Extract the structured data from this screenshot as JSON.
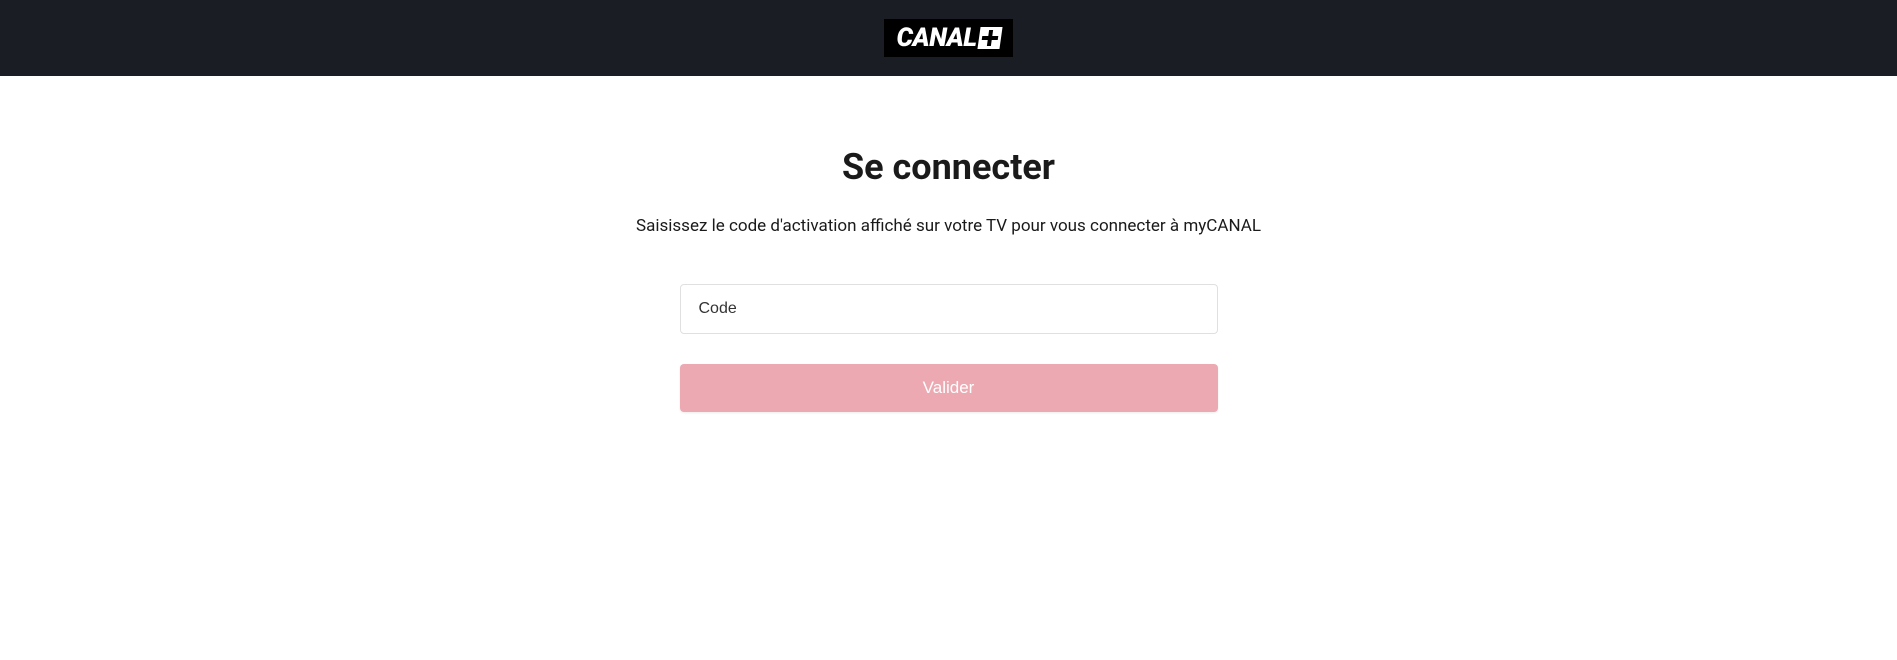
{
  "header": {
    "logo_text": "CANAL"
  },
  "main": {
    "title": "Se connecter",
    "subtitle": "Saisissez le code d'activation affiché sur votre TV pour vous connecter à myCANAL",
    "code_placeholder": "Code",
    "submit_label": "Valider"
  }
}
